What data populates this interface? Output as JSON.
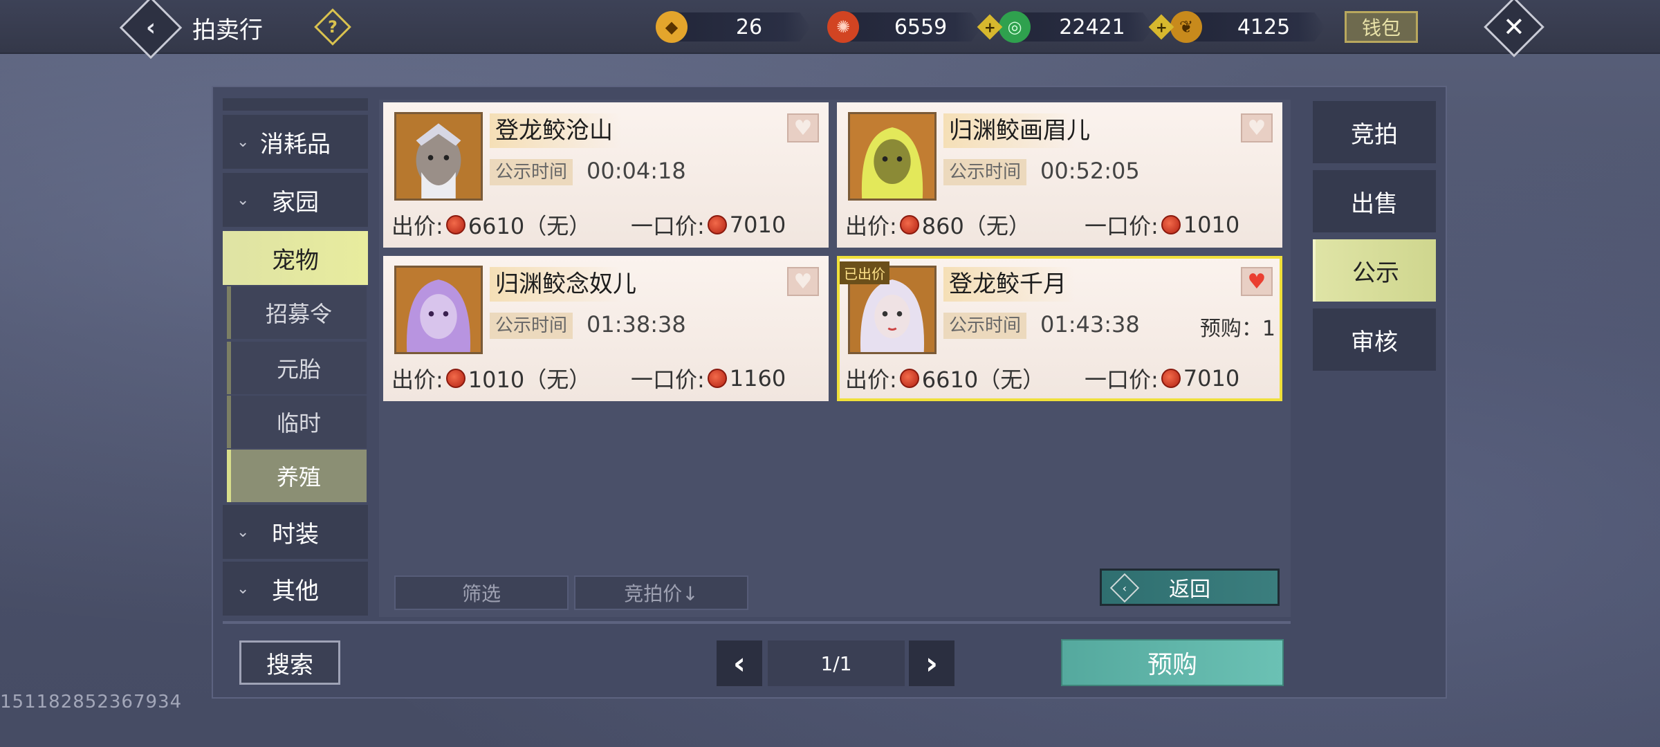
{
  "header": {
    "title": "拍卖行",
    "help_icon": "?",
    "wallet_label": "钱包",
    "currencies": [
      {
        "name": "gold-ingot",
        "value": "26",
        "color": "#e4a52c"
      },
      {
        "name": "red-coin",
        "value": "6559",
        "color": "#d24422"
      },
      {
        "name": "jade-coin",
        "value": "22421",
        "color": "#2fa14e"
      },
      {
        "name": "gold-leaf",
        "value": "4125",
        "color": "#c88a1c"
      }
    ]
  },
  "categories": [
    {
      "label": "消耗品",
      "expanded": false
    },
    {
      "label": "家园",
      "expanded": false
    },
    {
      "label": "宠物",
      "active": true
    },
    {
      "label": "时装",
      "expanded": false
    },
    {
      "label": "其他",
      "expanded": false
    }
  ],
  "subcategories": [
    {
      "label": "招募令"
    },
    {
      "label": "元胎"
    },
    {
      "label": "临时"
    },
    {
      "label": "养殖",
      "active": true
    }
  ],
  "cards": [
    {
      "name": "登龙鲛沧山",
      "time_label": "公示时间",
      "time": "00:04:18",
      "bid_label": "出价:",
      "bid": "6610（无）",
      "buyout_label": "一口价:",
      "buyout": "7010",
      "favorited": false
    },
    {
      "name": "归渊鲛画眉儿",
      "time_label": "公示时间",
      "time": "00:52:05",
      "bid_label": "出价:",
      "bid": "860（无）",
      "buyout_label": "一口价:",
      "buyout": "1010",
      "favorited": false
    },
    {
      "name": "归渊鲛念奴儿",
      "time_label": "公示时间",
      "time": "01:38:38",
      "bid_label": "出价:",
      "bid": "1010（无）",
      "buyout_label": "一口价:",
      "buyout": "1160",
      "favorited": false
    },
    {
      "name": "登龙鲛千月",
      "time_label": "公示时间",
      "time": "01:43:38",
      "bid_label": "出价:",
      "bid": "6610（无）",
      "buyout_label": "一口价:",
      "buyout": "7010",
      "favorited": true,
      "tag": "已出价",
      "prebuy": "预购：1",
      "selected": true
    }
  ],
  "controls": {
    "filter": "筛选",
    "sort": "竞拍价↓",
    "return": "返回",
    "search": "搜索",
    "page": "1/1",
    "prebuy": "预购"
  },
  "right_tabs": [
    {
      "label": "竞拍"
    },
    {
      "label": "出售"
    },
    {
      "label": "公示",
      "active": true
    },
    {
      "label": "审核"
    }
  ],
  "user_id": "151182852367934"
}
